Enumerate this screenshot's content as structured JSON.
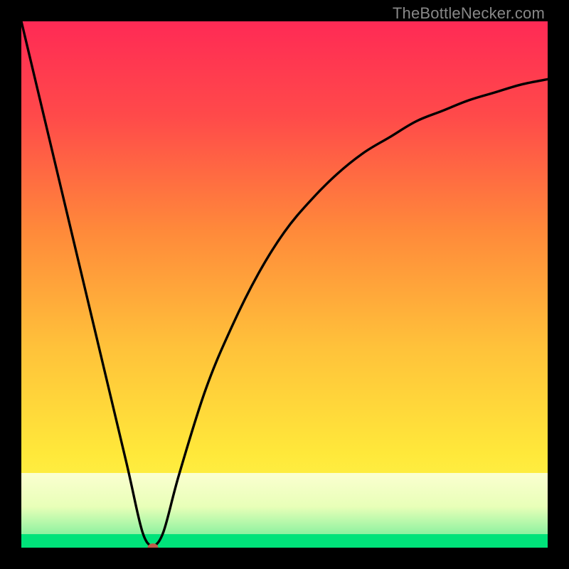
{
  "watermark": "TheBottleNecker.com",
  "colors": {
    "page_bg": "#000000",
    "curve": "#000000",
    "dot": "#c05b4b",
    "band_pale": "#faffd6",
    "band_green": "#00e37a",
    "gradient_top": "#ff2a55",
    "gradient_mid1": "#ff6a3a",
    "gradient_mid2": "#ffb43a",
    "gradient_mid3": "#ffe23a",
    "gradient_bottom": "#fff94d"
  },
  "chart_data": {
    "type": "line",
    "title": "",
    "xlabel": "",
    "ylabel": "",
    "xlim": [
      0,
      100
    ],
    "ylim": [
      0,
      100
    ],
    "grid": false,
    "legend": false,
    "annotations": [],
    "series": [
      {
        "name": "bottleneck-curve",
        "x": [
          0,
          5,
          10,
          15,
          20,
          23,
          25,
          27,
          30,
          35,
          40,
          45,
          50,
          55,
          60,
          65,
          70,
          75,
          80,
          85,
          90,
          95,
          100
        ],
        "y": [
          100,
          79,
          58,
          37,
          16,
          3,
          0,
          3,
          14,
          30,
          42,
          52,
          60,
          66,
          71,
          75,
          78,
          81,
          83,
          85,
          86.5,
          88,
          89
        ]
      }
    ],
    "marker": {
      "x": 25,
      "y": 0,
      "color": "#c05b4b"
    },
    "bottom_bands": [
      {
        "from_y": 0,
        "to_y": 2.5,
        "color": "#00e37a"
      },
      {
        "from_y": 2.5,
        "to_y": 14,
        "color_top": "#faffd6",
        "color_bottom": "#9ef3a9"
      }
    ]
  }
}
